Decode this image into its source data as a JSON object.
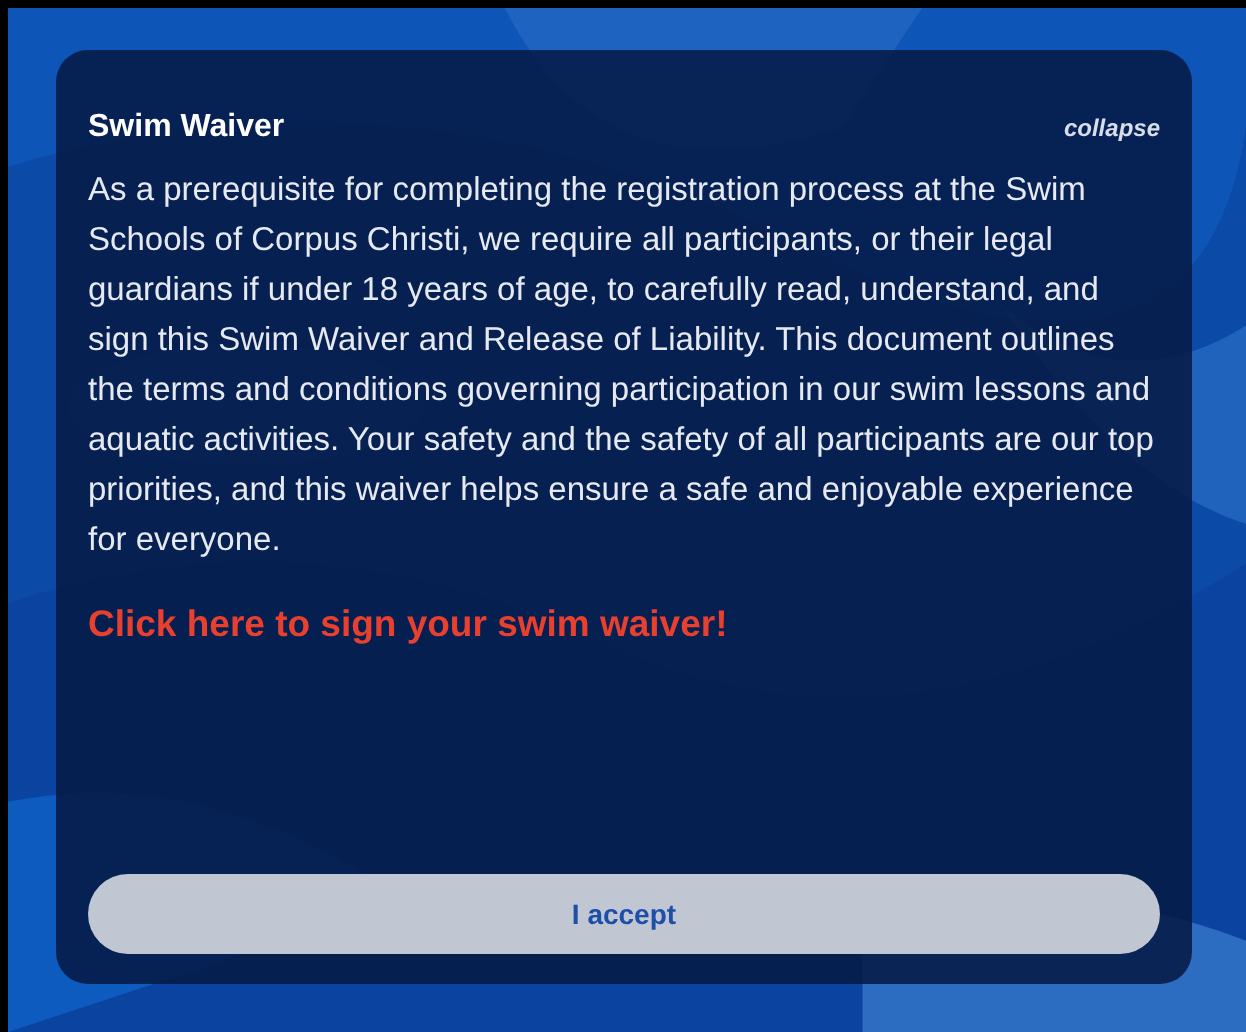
{
  "panel": {
    "title": "Swim Waiver",
    "collapse_label": "collapse",
    "body": "As a prerequisite for completing the registration process at the Swim Schools of Corpus Christi, we require all participants, or their legal guardians if under 18 years of age, to carefully read, understand, and sign this Swim Waiver and Release of Liability. This document outlines the terms and conditions governing participation in our swim lessons and aquatic activities. Your safety and the safety of all participants are our top priorities, and this waiver helps ensure a safe and enjoyable experience for everyone.",
    "link": "Click here to sign your swim waiver!",
    "accept_button": "I accept"
  }
}
